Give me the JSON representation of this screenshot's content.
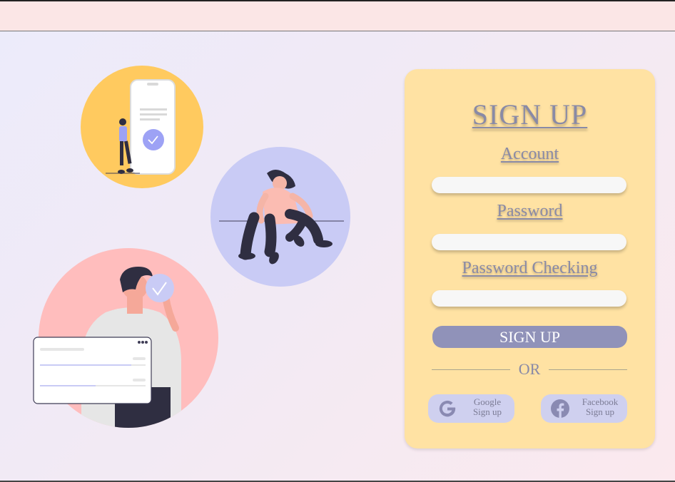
{
  "form": {
    "title": "SIGN UP",
    "account_label": "Account",
    "account_value": "",
    "password_label": "Password",
    "password_value": "",
    "password_check_label": "Password Checking",
    "password_check_value": "",
    "submit_label": "SIGN UP",
    "divider_text": "OR"
  },
  "social": [
    {
      "provider": "Google",
      "action": "Sign up",
      "icon": "google-icon"
    },
    {
      "provider": "Facebook",
      "action": "Sign up",
      "icon": "facebook-icon"
    }
  ],
  "colors": {
    "card": "#ffe2a3",
    "text_accent": "#898aa6",
    "button": "#9092b9",
    "social_button": "#cfd0ef",
    "illus_yellow": "#ffca5f",
    "illus_lavender": "#c9cbf5",
    "illus_pink": "#ffbdbd"
  }
}
